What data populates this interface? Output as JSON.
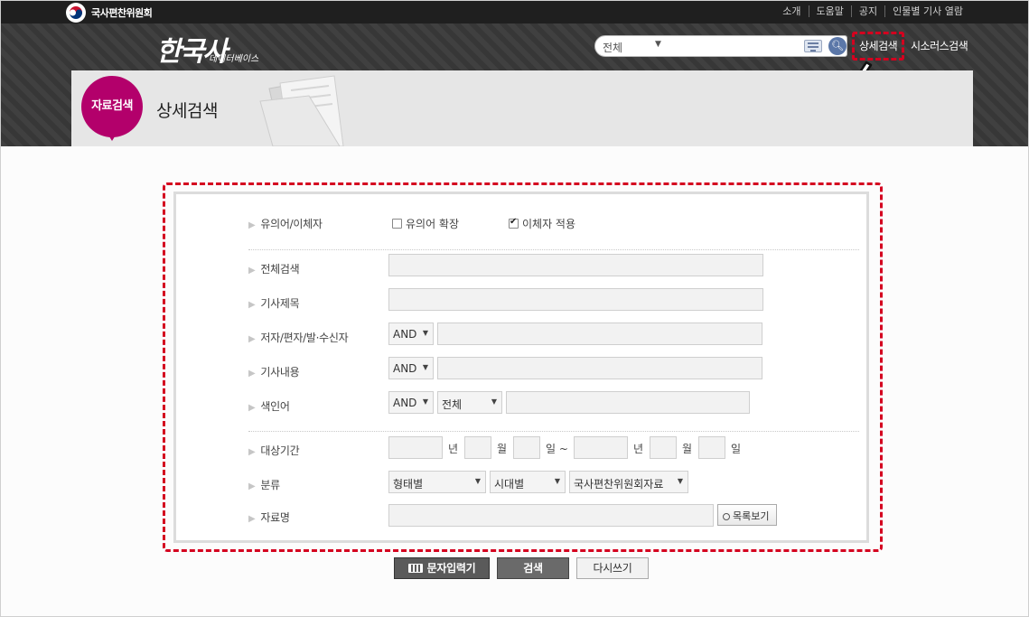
{
  "top_bar": {
    "org_name": "국사편찬위원회",
    "links": [
      "소개",
      "도움말",
      "공지",
      "인물별 기사 열람"
    ]
  },
  "header": {
    "brand_main": "한국사",
    "brand_sub": "데이터베이스",
    "search": {
      "scope": "전체",
      "value": ""
    },
    "advanced_search_link": "상세검색",
    "thesaurus_link": "시소러스검색"
  },
  "banner": {
    "badge": "자료검색",
    "title": "상세검색"
  },
  "form": {
    "synonym_label": "유의어/이체자",
    "synonym_expand": {
      "label": "유의어 확장",
      "checked": false
    },
    "variant_apply": {
      "label": "이체자 적용",
      "checked": true
    },
    "rows": [
      {
        "label": "전체검색"
      },
      {
        "label": "기사제목"
      },
      {
        "label": "저자/편자/발·수신자",
        "operator": "AND"
      },
      {
        "label": "기사내용",
        "operator": "AND"
      },
      {
        "label": "색인어",
        "operator": "AND",
        "scope": "전체"
      }
    ],
    "period": {
      "label": "대상기간",
      "units": [
        "년",
        "월",
        "일 ~",
        "년",
        "월",
        "일"
      ]
    },
    "classification": {
      "label": "분류",
      "selects": [
        "형태별",
        "시대별",
        "국사편찬위원회자료"
      ]
    },
    "material_name": {
      "label": "자료명",
      "list_button": "목록보기"
    }
  },
  "buttons": {
    "keyboard": "문자입력기",
    "search": "검색",
    "reset": "다시쓰기"
  },
  "colors": {
    "accent_magenta": "#b3006b",
    "highlight_red": "#d4001f",
    "header_dark": "#3a3a3a"
  }
}
